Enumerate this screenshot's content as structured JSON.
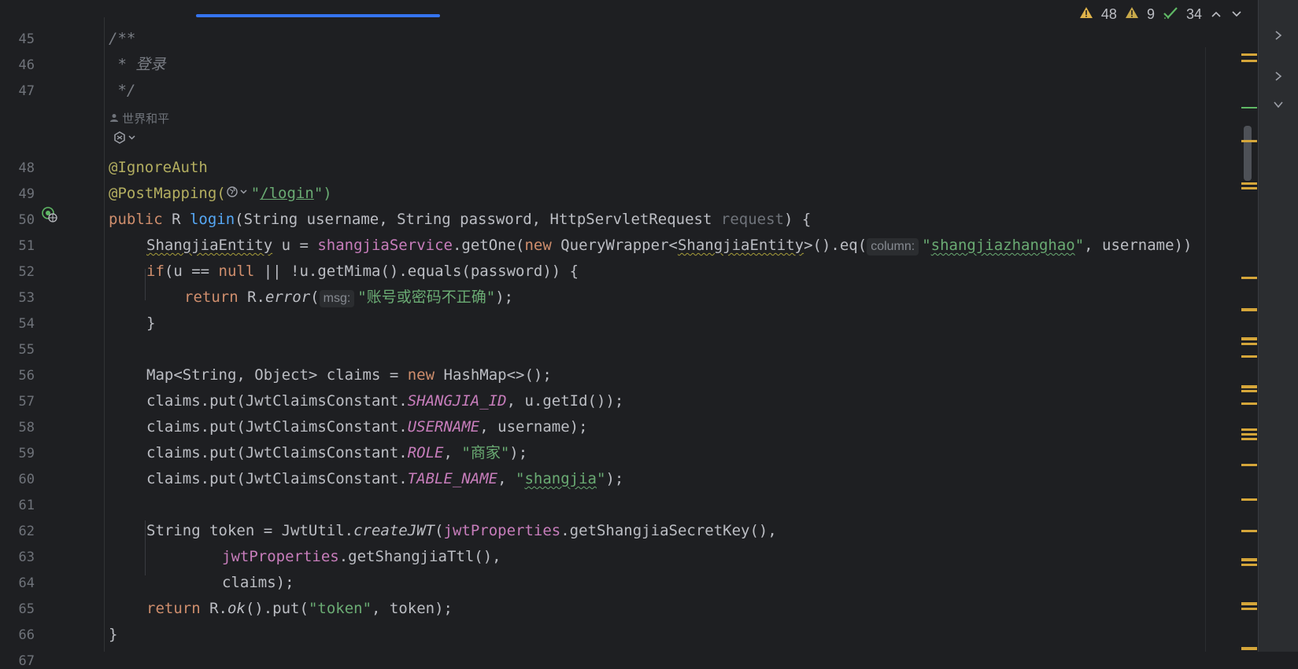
{
  "inspections": {
    "warnings": "48",
    "weak_warnings": "9",
    "typos": "34"
  },
  "author": "世界和平",
  "line_numbers": [
    "45",
    "46",
    "47",
    "48",
    "49",
    "50",
    "51",
    "52",
    "53",
    "54",
    "55",
    "56",
    "57",
    "58",
    "59",
    "60",
    "61",
    "62",
    "63",
    "64",
    "65",
    "66",
    "67"
  ],
  "code": {
    "l45": "/**",
    "l46": " * 登录",
    "l47": " */",
    "l48": "@IgnoreAuth",
    "l49_a": "@PostMapping(",
    "l49_b": "\"",
    "l49_c": "/login",
    "l49_d": "\")",
    "l50_a": "public",
    "l50_b": " R ",
    "l50_c": "login",
    "l50_d": "(String username, String password, HttpServletRequest ",
    "l50_e": "request",
    "l50_f": ") {",
    "l51_a": "ShangjiaEntity",
    "l51_b": " u = ",
    "l51_c": "shangjiaService",
    "l51_d": ".getOne(",
    "l51_e": "new",
    "l51_f": " QueryWrapper<",
    "l51_g": "ShangjiaEntity",
    "l51_h": ">().eq(",
    "l51_hint": "column:",
    "l51_i": "\"",
    "l51_j": "shangjiazhanghao",
    "l51_k": "\"",
    "l51_l": ", username))",
    "l52_a": "if",
    "l52_b": "(u == ",
    "l52_c": "null",
    "l52_d": " || !u.getMima().equals(password)) {",
    "l53_a": "return",
    "l53_b": " R.",
    "l53_c": "error",
    "l53_d": "(",
    "l53_hint": "msg:",
    "l53_e": "\"账号或密码不正确\"",
    "l53_f": ");",
    "l54": "}",
    "l56_a": "Map<String, Object> claims = ",
    "l56_b": "new",
    "l56_c": " HashMap<>();",
    "l57_a": "claims.put(JwtClaimsConstant.",
    "l57_b": "SHANGJIA_ID",
    "l57_c": ", u.getId());",
    "l58_a": "claims.put(JwtClaimsConstant.",
    "l58_b": "USERNAME",
    "l58_c": ", username);",
    "l59_a": "claims.put(JwtClaimsConstant.",
    "l59_b": "ROLE",
    "l59_c": ", ",
    "l59_d": "\"商家\"",
    "l59_e": ");",
    "l60_a": "claims.put(JwtClaimsConstant.",
    "l60_b": "TABLE_NAME",
    "l60_c": ", ",
    "l60_d": "\"",
    "l60_e": "shangjia",
    "l60_f": "\"",
    "l60_g": ");",
    "l62_a": "String token = JwtUtil.",
    "l62_b": "createJWT",
    "l62_c": "(",
    "l62_d": "jwtProperties",
    "l62_e": ".getShangjiaSecretKey(),",
    "l63_a": "jwtProperties",
    "l63_b": ".getShangjiaTtl(),",
    "l64": "claims);",
    "l65_a": "return",
    "l65_b": " R.",
    "l65_c": "ok",
    "l65_d": "().put(",
    "l65_e": "\"token\"",
    "l65_f": ", token);",
    "l66": "}"
  },
  "colors": {
    "background": "#1e1f22",
    "keyword": "#cf8e6d",
    "string": "#6aab73",
    "function": "#56a8f5",
    "annotation": "#b3ae60",
    "field": "#c77dbb",
    "accent": "#3574f0"
  },
  "icons": [
    "warning-icon",
    "check-icon",
    "chevron-up-icon",
    "chevron-down-icon",
    "globe-endpoint-icon",
    "person-icon",
    "ai-icon",
    "chevron-right-icon"
  ]
}
